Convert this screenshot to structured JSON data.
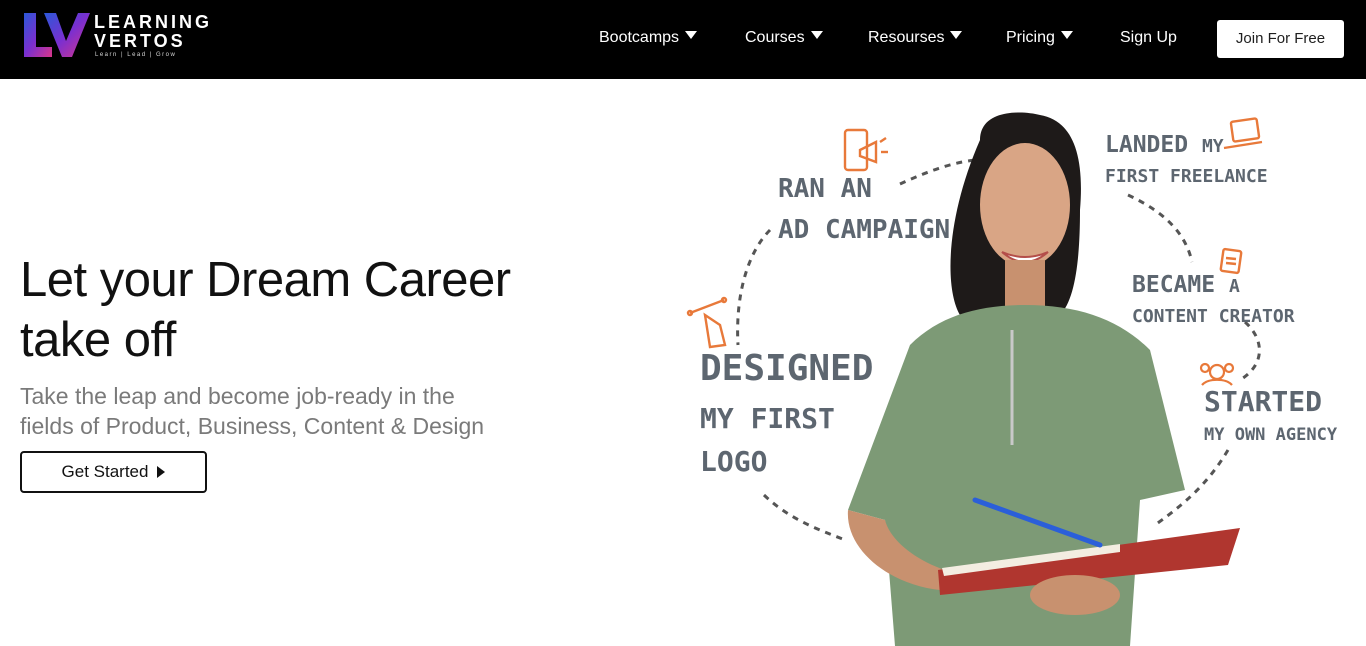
{
  "brand": {
    "name_line1": "LEARNING",
    "name_line2": "VERTOS",
    "tagline": "Learn | Lead | Grow"
  },
  "nav": {
    "items": [
      {
        "label": "Bootcamps",
        "dropdown": true
      },
      {
        "label": "Courses",
        "dropdown": true
      },
      {
        "label": "Resourses",
        "dropdown": true
      },
      {
        "label": "Pricing",
        "dropdown": true
      }
    ],
    "signup": "Sign Up",
    "join": "Join For Free"
  },
  "hero": {
    "title_line1": "Let your Dream Career",
    "title_line2": "take off",
    "subtitle_line1": "Take the leap and become job-ready in the",
    "subtitle_line2": "fields of Product, Business, Content & Design",
    "cta": "Get Started"
  },
  "milestones": {
    "ad_line1": "RAN AN",
    "ad_line2": "AD CAMPAIGN",
    "freelance_line1a": "LANDED",
    "freelance_line1b": "MY",
    "freelance_line2": "FIRST FREELANCE",
    "creator_line1a": "BECAME",
    "creator_line1b": "A",
    "creator_line2": "CONTENT CREATOR",
    "logo_line1": "DESIGNED",
    "logo_line2": "MY FIRST",
    "logo_line3": "LOGO",
    "agency_line1": "STARTED",
    "agency_line2": "MY OWN AGENCY"
  },
  "icons": [
    "megaphone-phone-icon",
    "laptop-icon",
    "document-icon",
    "pen-tool-icon",
    "team-icon"
  ],
  "colors": {
    "nav_bg": "#000000",
    "accent_orange": "#e8793a",
    "milestone_text": "#5d6670",
    "subtitle": "#7a7a7a",
    "shirt": "#7d9a76",
    "book": "#b0362f"
  }
}
